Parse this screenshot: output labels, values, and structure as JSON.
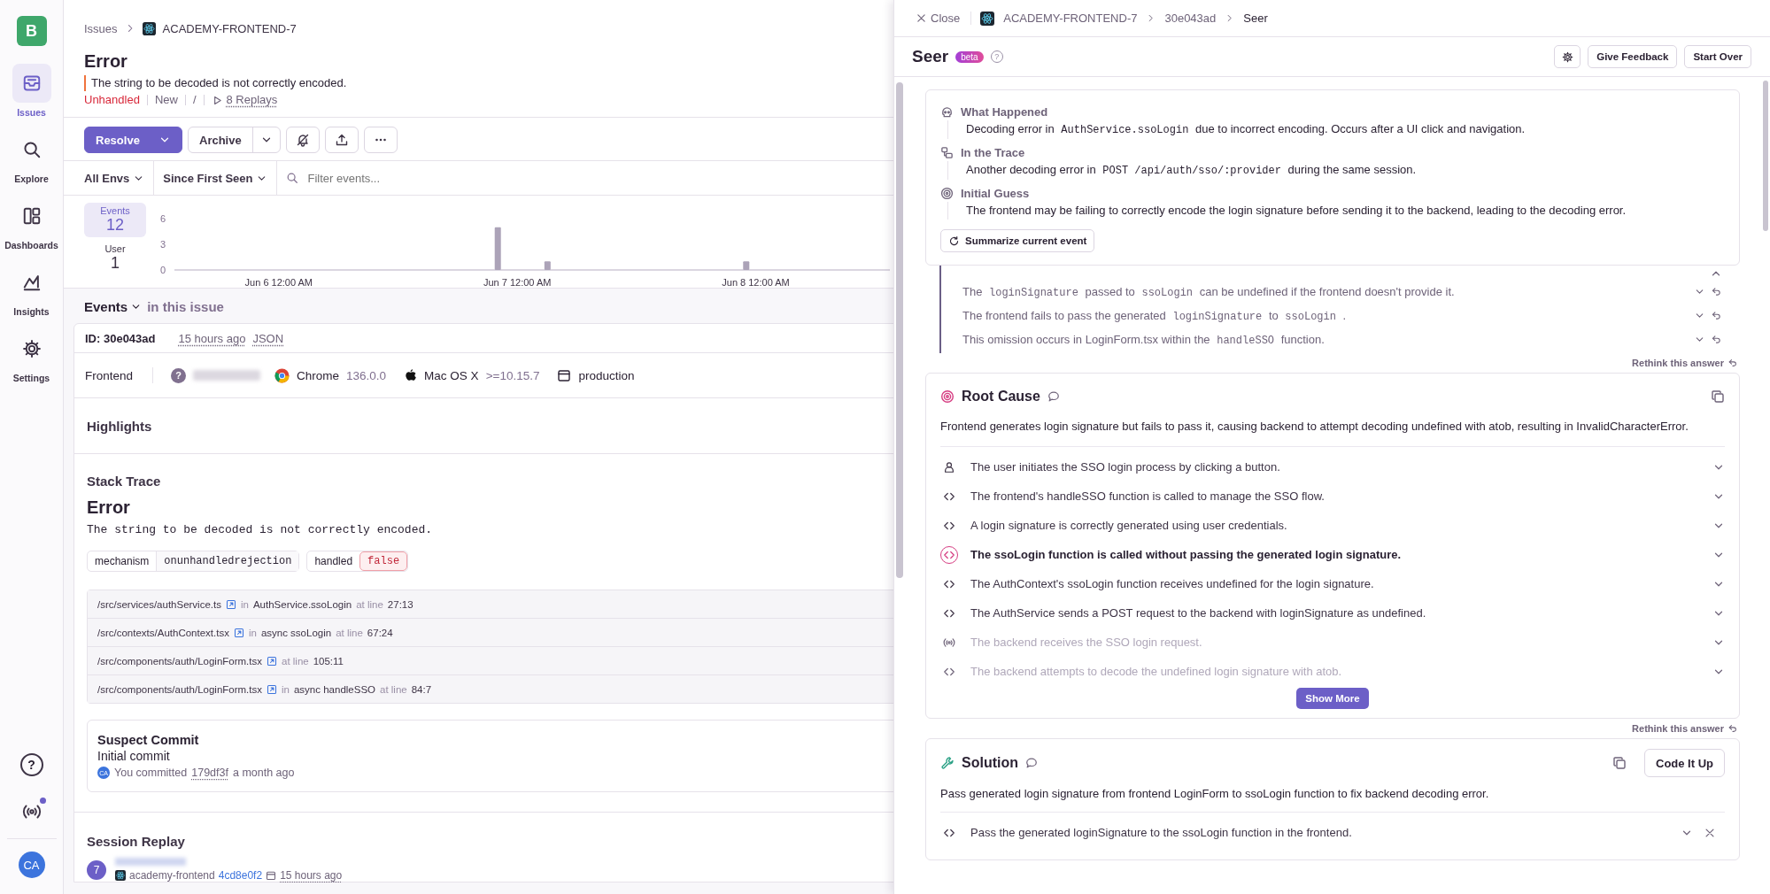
{
  "sidebar": {
    "logo": "B",
    "items": [
      {
        "label": "Issues",
        "selected": true
      },
      {
        "label": "Explore",
        "selected": false
      },
      {
        "label": "Dashboards",
        "selected": false
      },
      {
        "label": "Insights",
        "selected": false
      },
      {
        "label": "Settings",
        "selected": false
      }
    ],
    "help": "?",
    "broadcast_unread": true,
    "avatar": "CA"
  },
  "issue": {
    "breadcrumb": [
      "Issues",
      "ACADEMY-FRONTEND-7"
    ],
    "title": "Error",
    "message": "The string to be decoded is not correctly encoded.",
    "status": "Unhandled",
    "substatus": "New",
    "separator": "/",
    "replays": "8 Replays",
    "actions": {
      "resolve": "Resolve",
      "archive": "Archive"
    },
    "filters": {
      "environment": "All Envs",
      "period": "Since First Seen",
      "search_placeholder": "Filter events..."
    },
    "stats": [
      {
        "label": "Events",
        "value": "12",
        "selected": true
      },
      {
        "label": "User",
        "value": "1",
        "selected": false
      }
    ],
    "chart_data": {
      "type": "bar",
      "categories": [
        null,
        null,
        null,
        null,
        null,
        null,
        null,
        null,
        null,
        null,
        "Jun 6 12:00 AM",
        null,
        null,
        null,
        null,
        null,
        null,
        null,
        null,
        null,
        null,
        null,
        null,
        null,
        null,
        null,
        null,
        null,
        null,
        null,
        null,
        null,
        null,
        null,
        "Jun 7 12:00 AM",
        null,
        null,
        null,
        null,
        null,
        null,
        null,
        null,
        null,
        null,
        null,
        null,
        null,
        null,
        null,
        null,
        null,
        null,
        null,
        null,
        null,
        null,
        null,
        "Jun 8 12:00 AM",
        null,
        null,
        null,
        null,
        null,
        null,
        null,
        null,
        null,
        null,
        null,
        null,
        null
      ],
      "values": [
        0,
        0,
        0,
        0,
        0,
        0,
        0,
        0,
        0,
        0,
        0,
        0,
        0,
        0,
        0,
        0,
        0,
        0,
        0,
        0,
        0,
        0,
        0,
        0,
        0,
        0,
        0,
        0,
        0,
        0,
        0,
        0,
        5,
        0,
        0,
        0,
        0,
        1,
        0,
        0,
        0,
        0,
        0,
        0,
        0,
        0,
        0,
        0,
        0,
        0,
        0,
        0,
        0,
        0,
        0,
        0,
        0,
        1,
        0,
        0,
        0,
        0,
        0,
        0,
        0,
        0,
        0,
        0,
        0,
        0,
        0,
        0
      ],
      "ylim": [
        0,
        6
      ],
      "yticks": [
        0,
        3,
        6
      ]
    },
    "events_header": {
      "title": "Events",
      "scope": "in this issue"
    },
    "event": {
      "id": "ID: 30e043ad",
      "time": "15 hours ago",
      "json": "JSON",
      "project": "Frontend",
      "user_icon": "?",
      "browser": "Chrome",
      "browser_version": "136.0.0",
      "os": "Mac OS X",
      "os_version": ">=10.15.7",
      "environment": "production"
    },
    "highlights_title": "Highlights",
    "stack_trace": {
      "title": "Stack Trace",
      "type": "Error",
      "value": "The string to be decoded is not correctly encoded.",
      "tags": [
        {
          "key": "mechanism",
          "value": "onunhandledrejection",
          "alert": false
        },
        {
          "key": "handled",
          "value": "false",
          "alert": true
        }
      ],
      "frames": [
        {
          "file": "/src/services/authService.ts",
          "in": "in",
          "function": "AuthService.ssoLogin",
          "at": "at line",
          "line": "27:13"
        },
        {
          "file": "/src/contexts/AuthContext.tsx",
          "in": "in",
          "function": "async ssoLogin",
          "at": "at line",
          "line": "67:24"
        },
        {
          "file": "/src/components/auth/LoginForm.tsx",
          "at": "at line",
          "line": "105:11"
        },
        {
          "file": "/src/components/auth/LoginForm.tsx",
          "in": "in",
          "function": "async handleSSO",
          "at": "at line",
          "line": "84:7"
        }
      ]
    },
    "suspect_commit": {
      "title": "Suspect Commit",
      "message": "Initial commit",
      "author": "CA",
      "prefix": "You committed",
      "hash": "179df3f",
      "when": "a month ago"
    },
    "session_replay": {
      "title": "Session Replay",
      "count": "7",
      "project": "academy-frontend",
      "id": "4cd8e0f2",
      "time": "15 hours ago"
    }
  },
  "seer": {
    "close": "Close",
    "breadcrumb": [
      "ACADEMY-FRONTEND-7",
      "30e043ad",
      "Seer"
    ],
    "title": "Seer",
    "badge": "beta",
    "help": "?",
    "buttons": [
      "Give Feedback",
      "Start Over"
    ],
    "summary": [
      {
        "kind": "what",
        "title": "What Happened",
        "segments": [
          {
            "text": "Decoding error in ",
            "code": false
          },
          {
            "text": "AuthService.ssoLogin",
            "code": true
          },
          {
            "text": " due to incorrect encoding.  Occurs after a UI click and navigation.",
            "code": false
          }
        ]
      },
      {
        "kind": "trace",
        "title": "In the Trace",
        "segments": [
          {
            "text": "Another decoding error in ",
            "code": false
          },
          {
            "text": "POST /api/auth/sso/:provider",
            "code": true
          },
          {
            "text": " during the same session.",
            "code": false
          }
        ]
      },
      {
        "kind": "guess",
        "title": "Initial Guess",
        "segments": [
          {
            "text": "The frontend may be failing to correctly encode the login signature before sending it to the backend, leading to the decoding error.",
            "code": false
          }
        ]
      }
    ],
    "summarize_button": "Summarize current event",
    "insights": [
      {
        "segments": [
          {
            "text": "The ",
            "code": false
          },
          {
            "text": "loginSignature",
            "code": true
          },
          {
            "text": " passed to ",
            "code": false
          },
          {
            "text": "ssoLogin",
            "code": true
          },
          {
            "text": " can be undefined if the frontend doesn't provide it.",
            "code": false
          }
        ]
      },
      {
        "segments": [
          {
            "text": "The frontend fails to pass the generated ",
            "code": false
          },
          {
            "text": "loginSignature",
            "code": true
          },
          {
            "text": " to ",
            "code": false
          },
          {
            "text": "ssoLogin",
            "code": true
          },
          {
            "text": " .",
            "code": false
          }
        ]
      },
      {
        "segments": [
          {
            "text": "This omission occurs in LoginForm.tsx within the ",
            "code": false
          },
          {
            "text": "handleSSO",
            "code": true
          },
          {
            "text": " function.",
            "code": false
          }
        ]
      }
    ],
    "insights_rethink": "Rethink this answer",
    "root_cause": {
      "title": "Root Cause",
      "description": "Frontend generates login signature but fails to pass it, causing backend to attempt decoding undefined with atob, resulting in InvalidCharacterError.",
      "steps": [
        {
          "kind": "user",
          "text": "The user initiates the SSO login process by clicking a button.",
          "highlighted": false,
          "dimmed": false
        },
        {
          "kind": "code",
          "text": "The frontend's handleSSO function is called to manage the SSO flow.",
          "highlighted": false,
          "dimmed": false
        },
        {
          "kind": "code",
          "text": "A login signature is correctly generated using user credentials.",
          "highlighted": false,
          "dimmed": false
        },
        {
          "kind": "code",
          "text": "The ssoLogin function is called without passing the generated login signature.",
          "highlighted": true,
          "dimmed": false
        },
        {
          "kind": "code",
          "text": "The AuthContext's ssoLogin function receives undefined for the login signature.",
          "highlighted": false,
          "dimmed": false
        },
        {
          "kind": "code",
          "text": "The AuthService sends a POST request to the backend with loginSignature as undefined.",
          "highlighted": false,
          "dimmed": false
        },
        {
          "kind": "network",
          "text": "The backend receives the SSO login request.",
          "highlighted": false,
          "dimmed": true
        },
        {
          "kind": "code",
          "text": "The backend attempts to decode the undefined login signature with atob.",
          "highlighted": false,
          "dimmed": true
        }
      ],
      "show_more": "Show More",
      "rethink": "Rethink this answer"
    },
    "solution": {
      "title": "Solution",
      "button": "Code It Up",
      "description": "Pass generated login signature from frontend LoginForm to ssoLogin function to fix backend decoding error.",
      "steps": [
        {
          "kind": "code",
          "text": "Pass the generated loginSignature to the ssoLogin function in the frontend."
        }
      ]
    }
  }
}
